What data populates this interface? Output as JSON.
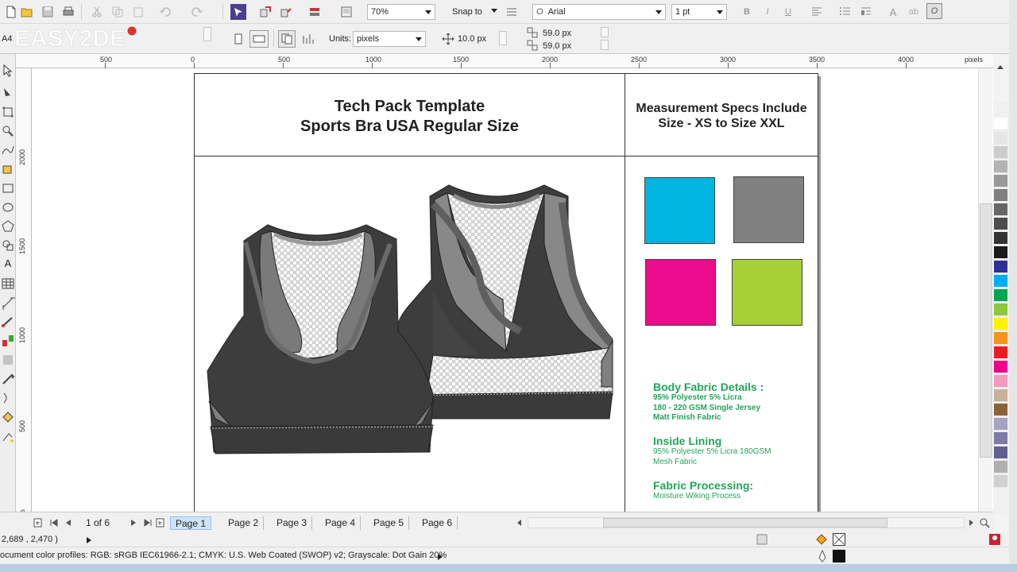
{
  "toolbar": {
    "zoom": "70%",
    "snap_to": "Snap to",
    "font_name": "Arial",
    "outline_width": "1 pt"
  },
  "property_bar": {
    "page_size": "A4",
    "units_label": "Units:",
    "units_value": "pixels",
    "nudge_distance": "10.0 px",
    "dup_x": "59.0 px",
    "dup_y": "59.0 px"
  },
  "ruler": {
    "h_labels": [
      "500",
      "0",
      "500",
      "1000",
      "1500",
      "2000",
      "2500",
      "3000",
      "3500",
      "4000"
    ],
    "h_unit": "pixels",
    "v_labels": [
      "2000",
      "1500",
      "1000",
      "500"
    ],
    "v_unit": "pixels"
  },
  "document": {
    "title_line1": "Tech Pack Template",
    "title_line2": "Sports Bra USA Regular Size",
    "spec_line1": "Measurement Specs Include",
    "spec_line2": "Size - XS to Size XXL",
    "swatches": [
      "#00b5e0",
      "#808080",
      "#ec0b8c",
      "#a6cf35"
    ],
    "body_fabric_heading": "Body Fabric Details :",
    "body_fabric_lines": [
      "95% Polyester 5% Licra",
      "180 - 220 GSM Single Jersey",
      "Matt Finish Fabric"
    ],
    "lining_heading": "Inside Lining",
    "lining_lines": [
      "95% Polyester 5% Licra 180GSM",
      "Mesh Fabric"
    ],
    "processing_heading": "Fabric Processing:",
    "processing_lines": [
      "Moisture Wiking Process"
    ]
  },
  "pages": {
    "counter": "1 of 6",
    "tabs": [
      "Page 1",
      "Page 2",
      "Page 3",
      "Page 4",
      "Page 5",
      "Page 6"
    ],
    "active_index": 0
  },
  "status": {
    "cursor_coords": "2,689 , 2,470 )",
    "color_profiles": "ocument color profiles: RGB: sRGB IEC61966-2.1; CMYK: U.S. Web Coated (SWOP) v2; Grayscale: Dot Gain 20%"
  },
  "palette": [
    "#ffffff",
    "#e6e6e6",
    "#cccccc",
    "#b3b3b3",
    "#999999",
    "#808080",
    "#666666",
    "#4d4d4d",
    "#333333",
    "#1a1a1a",
    "#2e3192",
    "#00aeef",
    "#00a651",
    "#8dc63f",
    "#fff200",
    "#f7941d",
    "#ed1c24",
    "#ec008c",
    "#f49ac1",
    "#c7b299",
    "#8c6239",
    "#a3a3c2",
    "#7b7ba8",
    "#606090",
    "#b0b0b0",
    "#d0d0d0"
  ]
}
